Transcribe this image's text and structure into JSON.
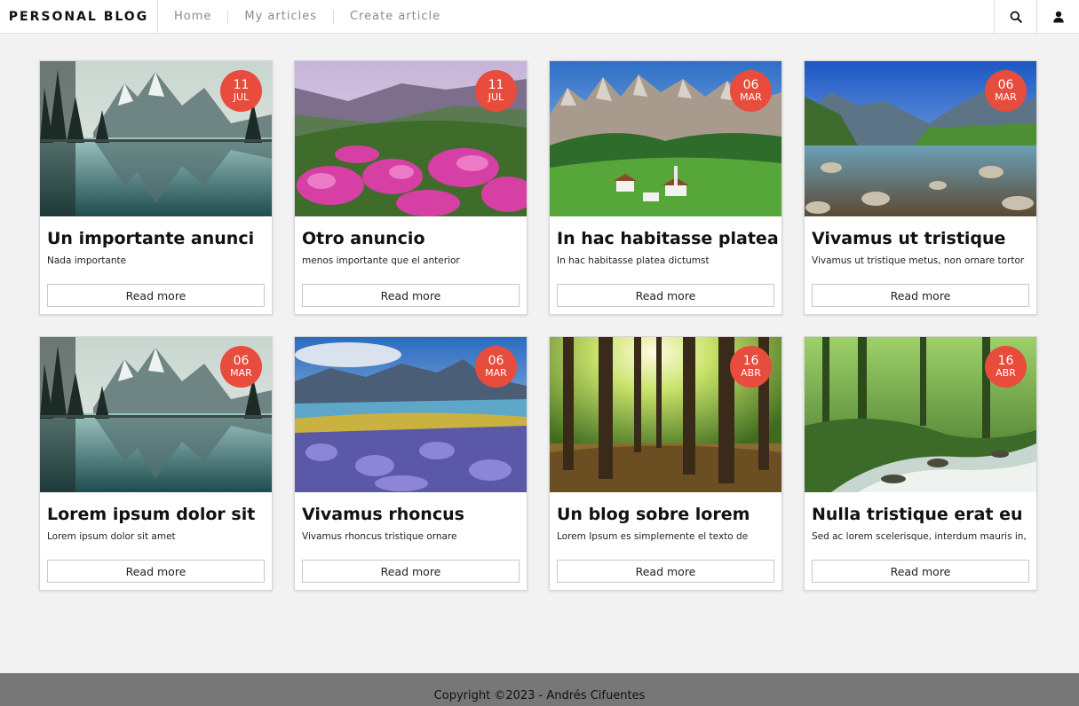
{
  "header": {
    "brand": "PERSONAL BLOG",
    "nav": [
      "Home",
      "My articles",
      "Create article"
    ],
    "icons": [
      "search-icon",
      "user-icon"
    ]
  },
  "colors": {
    "badge": "#e74c3c",
    "footer": "#777777",
    "page_background": "#f2f2f2"
  },
  "articles": [
    {
      "title": "Un importante anunci",
      "description": "Nada importante",
      "day": "11",
      "month": "JUL",
      "read_more": "Read more",
      "image": "mountain-lake-reflection"
    },
    {
      "title": "Otro anuncio",
      "description": "menos importante que el anterior",
      "day": "11",
      "month": "JUL",
      "read_more": "Read more",
      "image": "pink-flower-meadow"
    },
    {
      "title": "In hac habitasse platea",
      "description": "In hac habitasse platea dictumst",
      "day": "06",
      "month": "MAR",
      "read_more": "Read more",
      "image": "alpine-village-peaks"
    },
    {
      "title": "Vivamus ut tristique",
      "description": "Vivamus ut tristique metus, non ornare tortor",
      "day": "06",
      "month": "MAR",
      "read_more": "Read more",
      "image": "rocky-river-mountains"
    },
    {
      "title": "Lorem ipsum dolor sit",
      "description": "Lorem ipsum dolor sit amet",
      "day": "06",
      "month": "MAR",
      "read_more": "Read more",
      "image": "mountain-lake-reflection"
    },
    {
      "title": "Vivamus rhoncus",
      "description": "Vivamus rhoncus tristique ornare",
      "day": "06",
      "month": "MAR",
      "read_more": "Read more",
      "image": "lupine-field-lake"
    },
    {
      "title": "Un blog sobre lorem",
      "description": "Lorem Ipsum es simplemente el texto de",
      "day": "16",
      "month": "ABR",
      "read_more": "Read more",
      "image": "sunlit-forest"
    },
    {
      "title": "Nulla tristique erat eu",
      "description": "Sed ac lorem scelerisque, interdum mauris in,",
      "day": "16",
      "month": "ABR",
      "read_more": "Read more",
      "image": "forest-stream"
    }
  ],
  "footer": {
    "copyright": "Copyright ©2023 - Andrés Cifuentes"
  }
}
